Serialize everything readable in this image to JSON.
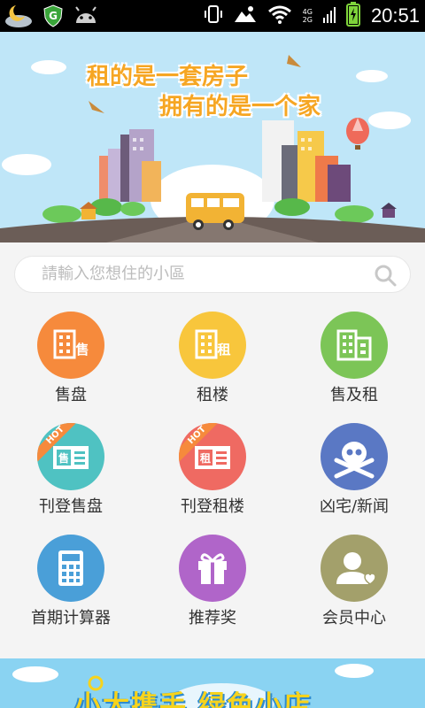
{
  "status_bar": {
    "time": "20:51",
    "network_top": "4G",
    "network_bottom": "2G",
    "icons": [
      "weather-moon-icon",
      "shield-app-icon",
      "android-icon",
      "vibrate-icon",
      "image-notification-icon",
      "wifi-icon",
      "signal-icon",
      "battery-charging-icon"
    ]
  },
  "banner": {
    "line1": "租的是一套房子",
    "line2": "拥有的是一个家",
    "colors": {
      "sky": "#bfe6f8",
      "text": "#f6a623",
      "road": "#6b5d57",
      "bus": "#f2b334"
    }
  },
  "search": {
    "placeholder": "請輸入您想住的小區"
  },
  "menu": [
    {
      "label": "售盘",
      "icon": "building-sale-icon",
      "color": "#f68a3c",
      "glyph": "售"
    },
    {
      "label": "租楼",
      "icon": "building-rent-icon",
      "color": "#f8c63c",
      "glyph": "租"
    },
    {
      "label": "售及租",
      "icon": "buildings-icon",
      "color": "#7cc557",
      "glyph": ""
    },
    {
      "label": "刊登售盘",
      "icon": "post-sale-icon",
      "color": "#4fc2c2",
      "glyph": "售",
      "badge": "HOT"
    },
    {
      "label": "刊登租楼",
      "icon": "post-rent-icon",
      "color": "#ef6a62",
      "glyph": "租",
      "badge": "HOT"
    },
    {
      "label": "凶宅/新闻",
      "icon": "skull-icon",
      "color": "#5a78c4",
      "glyph": ""
    },
    {
      "label": "首期计算器",
      "icon": "calculator-icon",
      "color": "#4a9fd8",
      "glyph": ""
    },
    {
      "label": "推荐奖",
      "icon": "gift-icon",
      "color": "#b065c9",
      "glyph": ""
    },
    {
      "label": "会员中心",
      "icon": "member-icon",
      "color": "#a3a06b",
      "glyph": ""
    }
  ],
  "bottom_banner": {
    "text": "小大携手 绿色小店",
    "color": "#8ad3f2"
  }
}
